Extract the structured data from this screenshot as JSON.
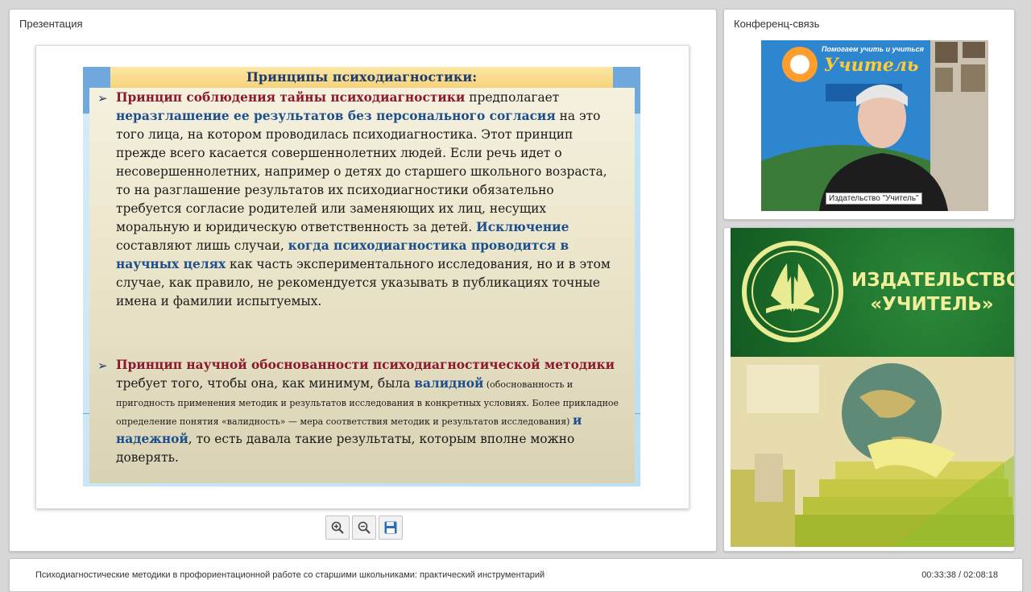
{
  "presentation": {
    "title": "Презентация",
    "slide": {
      "heading": "Принципы  психодиагностики:",
      "p1_a": "Принцип соблюдения тайны психодиагностики",
      "p1_b": " предполагает ",
      "p1_c": "неразглашение ее результатов без персонального согласия",
      "p1_d": " на это того лица, на котором проводилась психодиагностика. Этот принцип прежде всего касается совершеннолетних людей. Если речь идет о несовершеннолетних, например о детях до старшего школьного возраста, то на разглашение результатов их психодиагностики обязательно требуется согласие родителей или заменяющих их лиц, несущих моральную и юридическую ответственность за детей. ",
      "p1_e": "Исключение",
      "p1_f": " составляют лишь случаи, ",
      "p1_g": "когда психодиагностика проводится в научных целях",
      "p1_h": " как часть экспериментального исследования, но и в этом случае, как правило, не рекомендуется указывать в публикациях точные имена и фамилии испытуемых.",
      "p2_a": "Принцип научной обоснованности психодиагностической методики",
      "p2_b": " требует того, чтобы она, как минимум, была ",
      "p2_c": "валидной",
      "p2_d": " (обоснованность и пригодность применения методик и результатов исследования в конкретных условиях. Более прикладное определение понятия «валидность» — мера соответствия методик и результатов исследования) ",
      "p2_e": "и надежной",
      "p2_f": ", то есть давала такие результаты, которым вполне можно доверять."
    },
    "toolbar": {
      "zoom_in_icon": "zoom-in-icon",
      "zoom_out_icon": "zoom-out-icon",
      "save_icon": "floppy-disk-icon"
    }
  },
  "conference": {
    "title": "Конференц-связь",
    "video_caption": "Издательство \"Учитель\"",
    "poster_line1": "Помогаем учить и учиться",
    "poster_logo": "Учитель"
  },
  "banner": {
    "line1": "ИЗДАТЕЛЬСТВО",
    "line2": "«УЧИТЕЛЬ»"
  },
  "footer": {
    "title": "Психодиагностические методики в профориентационной работе со старшими школьниками: практический инструментарий",
    "time": "00:33:38 / 02:08:18"
  }
}
